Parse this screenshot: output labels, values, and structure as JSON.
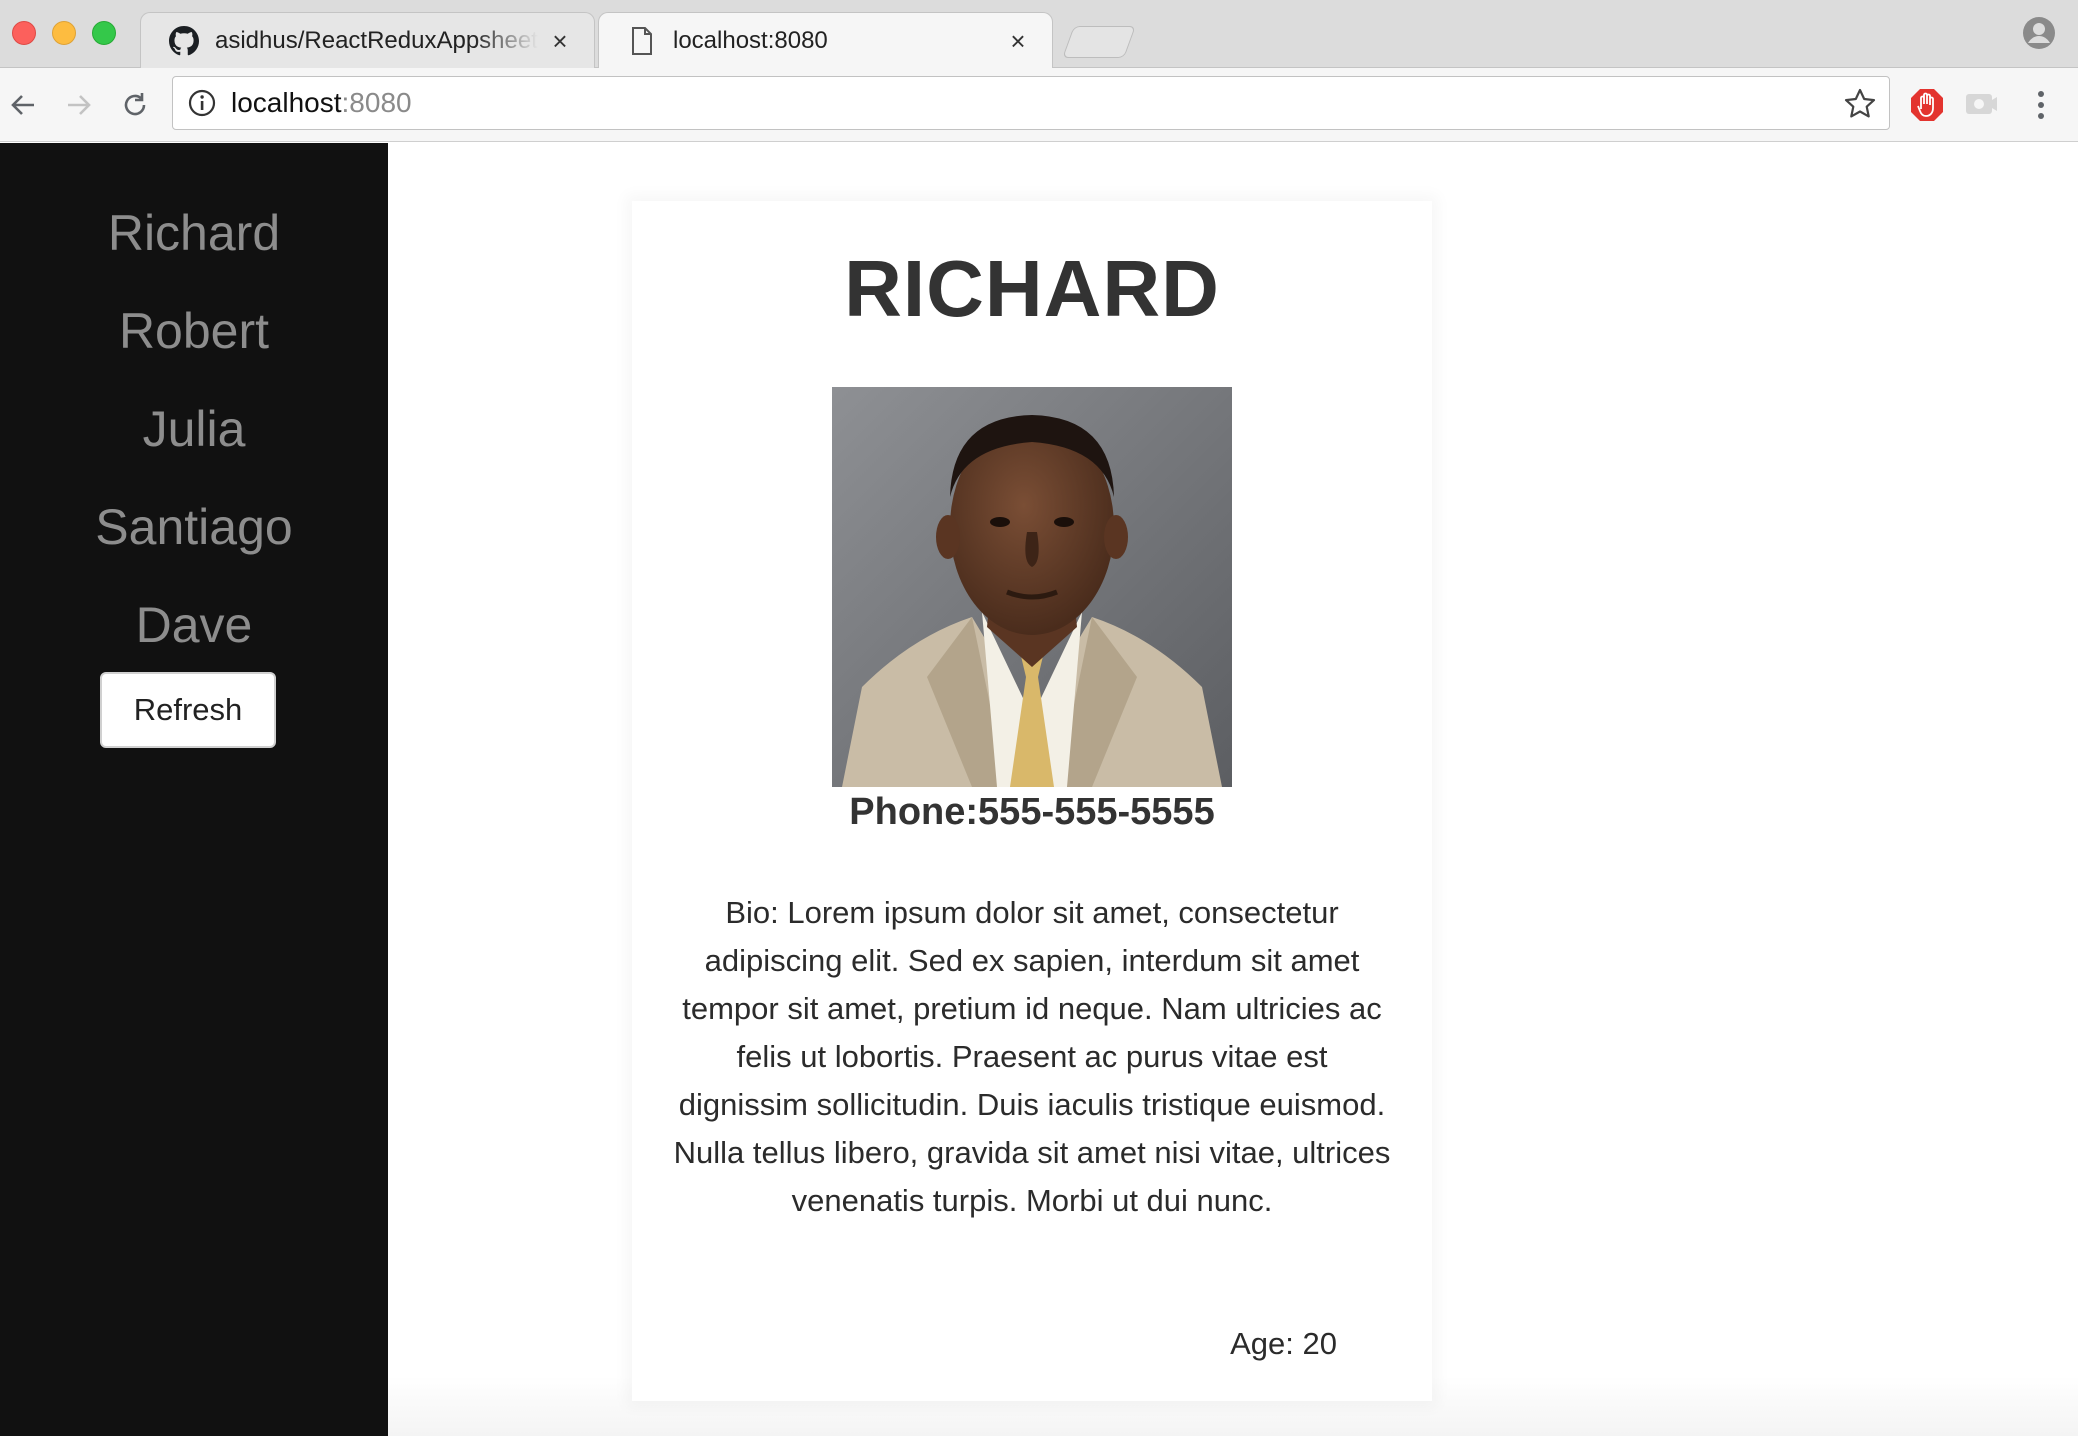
{
  "browser": {
    "tabs": [
      {
        "title": "asidhus/ReactReduxAppsheetC",
        "active": false,
        "icon": "github-icon"
      },
      {
        "title": "localhost:8080",
        "active": true,
        "icon": "document-icon"
      }
    ],
    "address": {
      "host": "localhost",
      "port": ":8080"
    }
  },
  "sidebar": {
    "items": [
      "Richard",
      "Robert",
      "Julia",
      "Santiago",
      "Dave"
    ],
    "refresh_label": "Refresh"
  },
  "profile": {
    "name": "RICHARD",
    "phone": "Phone:555-555-5555",
    "bio": "Bio: Lorem ipsum dolor sit amet, consectetur adipiscing elit. Sed ex sapien, interdum sit amet tempor sit amet, pretium id neque. Nam ultricies ac felis ut lobortis. Praesent ac purus vitae est dignissim sollicitudin. Duis iaculis tristique euismod. Nulla tellus libero, gravida sit amet nisi vitae, ultrices venenatis turpis. Morbi ut dui nunc.",
    "age": "Age: 20"
  },
  "colors": {
    "sidebar_bg": "#111111",
    "sidebar_text": "#8d8d8d",
    "heading_text": "#333333"
  }
}
